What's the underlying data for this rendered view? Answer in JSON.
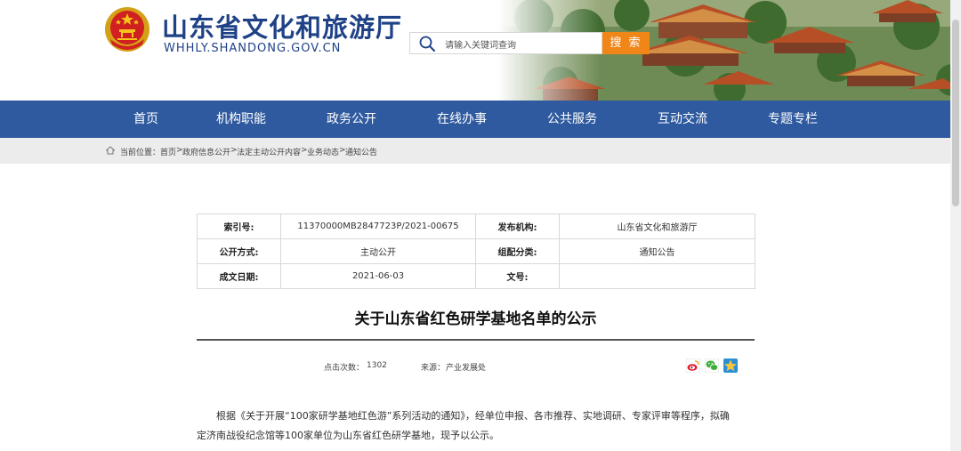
{
  "header": {
    "title": "山东省文化和旅游厅",
    "url": "WHHLY.SHANDONG.GOV.CN",
    "emblem_icon": "national-emblem-icon",
    "brand_color": "#1f4287"
  },
  "search": {
    "placeholder": "请输入关键词查询",
    "button_label": "搜 索",
    "button_color": "#f08518"
  },
  "nav": {
    "color": "#2f5a9f",
    "items": [
      {
        "label": "首页"
      },
      {
        "label": "机构职能"
      },
      {
        "label": "政务公开"
      },
      {
        "label": "在线办事"
      },
      {
        "label": "公共服务"
      },
      {
        "label": "互动交流"
      },
      {
        "label": "专题专栏"
      }
    ]
  },
  "breadcrumb": {
    "label": "当前位置：",
    "items": [
      "首页",
      "政府信息公开",
      "法定主动公开内容",
      "业务动态",
      "通知公告"
    ],
    "separator": ">"
  },
  "meta": {
    "index_label": "索引号:",
    "index_value": "11370000MB2847723P/2021-00675",
    "publisher_label": "发布机构:",
    "publisher_value": "山东省文化和旅游厅",
    "disclosure_label": "公开方式:",
    "disclosure_value": "主动公开",
    "category_label": "组配分类:",
    "category_value": "通知公告",
    "date_label": "成文日期:",
    "date_value": "2021-06-03",
    "doc_no_label": "文号:",
    "doc_no_value": ""
  },
  "article": {
    "title": "关于山东省红色研学基地名单的公示",
    "views_label": "点击次数：",
    "views_value": "1302",
    "source_label": "来源：",
    "source_value": "产业发展处",
    "share_icons": [
      "weibo-icon",
      "wechat-icon",
      "qzone-icon"
    ],
    "paragraph_line1": "根据《关于开展“100家研学基地红色游”系列活动的通知》，经单位申报、各市推荐、实地调研、专家评审等程序，拟确",
    "paragraph_line2": "定济南战役纪念馆等100家单位为山东省红色研学基地，现予以公示。"
  }
}
